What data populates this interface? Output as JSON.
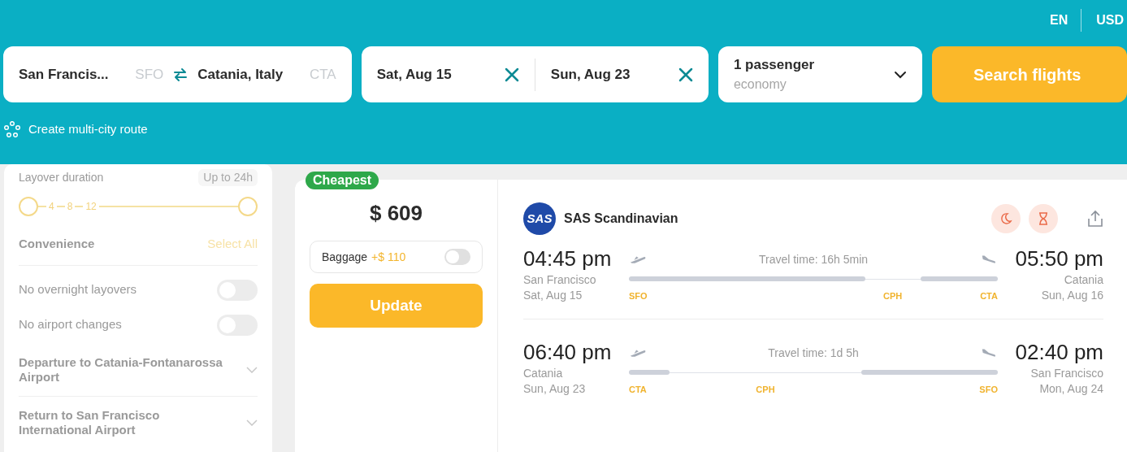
{
  "header": {
    "language": "EN",
    "currency": "USD"
  },
  "search": {
    "origin": {
      "city": "San Francis...",
      "code": "SFO"
    },
    "destination": {
      "city": "Catania, Italy",
      "code": "CTA"
    },
    "dates": [
      {
        "value": "Sat, Aug 15"
      },
      {
        "value": "Sun, Aug 23"
      }
    ],
    "passengers": {
      "count": "1 passenger",
      "cabin": "economy"
    },
    "submit": "Search flights"
  },
  "multi_city_link": "Create multi-city route",
  "filters": {
    "layover": {
      "label": "Layover duration",
      "value": "Up to 24h",
      "ticks": [
        "4",
        "8",
        "12"
      ]
    },
    "convenience": {
      "title": "Convenience",
      "select_all": "Select All",
      "options": [
        {
          "label": "No overnight layovers",
          "on": false
        },
        {
          "label": "No airport changes",
          "on": false
        }
      ]
    },
    "sections": [
      {
        "label": "Departure to Catania-Fontanarossa Airport",
        "expanded": false
      },
      {
        "label": "Return to San Francisco International Airport",
        "expanded": false
      }
    ]
  },
  "offer": {
    "badge": "Cheapest",
    "price": "$ 609",
    "baggage": {
      "label": "Baggage",
      "price": "+$ 110",
      "on": false
    },
    "button": "Update",
    "airline": {
      "logo_text": "SAS",
      "name": "SAS Scandinavian"
    },
    "legs": [
      {
        "depart_time": "04:45 pm",
        "depart_city": "San Francisco",
        "depart_date": "Sat, Aug 15",
        "travel_time": "Travel time: 16h 5min",
        "arrive_time": "05:50 pm",
        "arrive_city": "Catania",
        "arrive_date": "Sun, Aug 16",
        "segments": [
          {
            "kind": "flight"
          },
          {
            "kind": "layover",
            "code": "CPH"
          },
          {
            "kind": "flight"
          }
        ],
        "from": "SFO",
        "to": "CTA"
      },
      {
        "depart_time": "06:40 pm",
        "depart_city": "Catania",
        "depart_date": "Sun, Aug 23",
        "travel_time": "Travel time: 1d 5h",
        "arrive_time": "02:40 pm",
        "arrive_city": "San Francisco",
        "arrive_date": "Mon, Aug 24",
        "segments": [
          {
            "kind": "flight"
          },
          {
            "kind": "layover",
            "code": "CPH"
          },
          {
            "kind": "flight"
          }
        ],
        "from": "CTA",
        "to": "SFO"
      }
    ]
  }
}
